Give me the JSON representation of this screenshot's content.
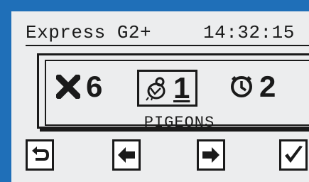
{
  "header": {
    "model": "Express G2+",
    "time": "14:32:15"
  },
  "counters": {
    "cross": {
      "icon": "x-mark-icon",
      "value": "6"
    },
    "pigeon": {
      "icon": "pigeon-icon",
      "value": "1"
    },
    "clock": {
      "icon": "clock-icon",
      "value": "2"
    }
  },
  "label": "PIGEONS",
  "buttons": [
    {
      "name": "back-button",
      "icon": "return-arrow-icon"
    },
    {
      "name": "left-button",
      "icon": "arrow-left-icon"
    },
    {
      "name": "right-button",
      "icon": "arrow-right-icon"
    },
    {
      "name": "confirm-button",
      "icon": "checkmark-icon"
    }
  ],
  "colors": {
    "bezel": "#1f6fb8",
    "screen": "#ecedee",
    "ink": "#1a1a1a"
  }
}
